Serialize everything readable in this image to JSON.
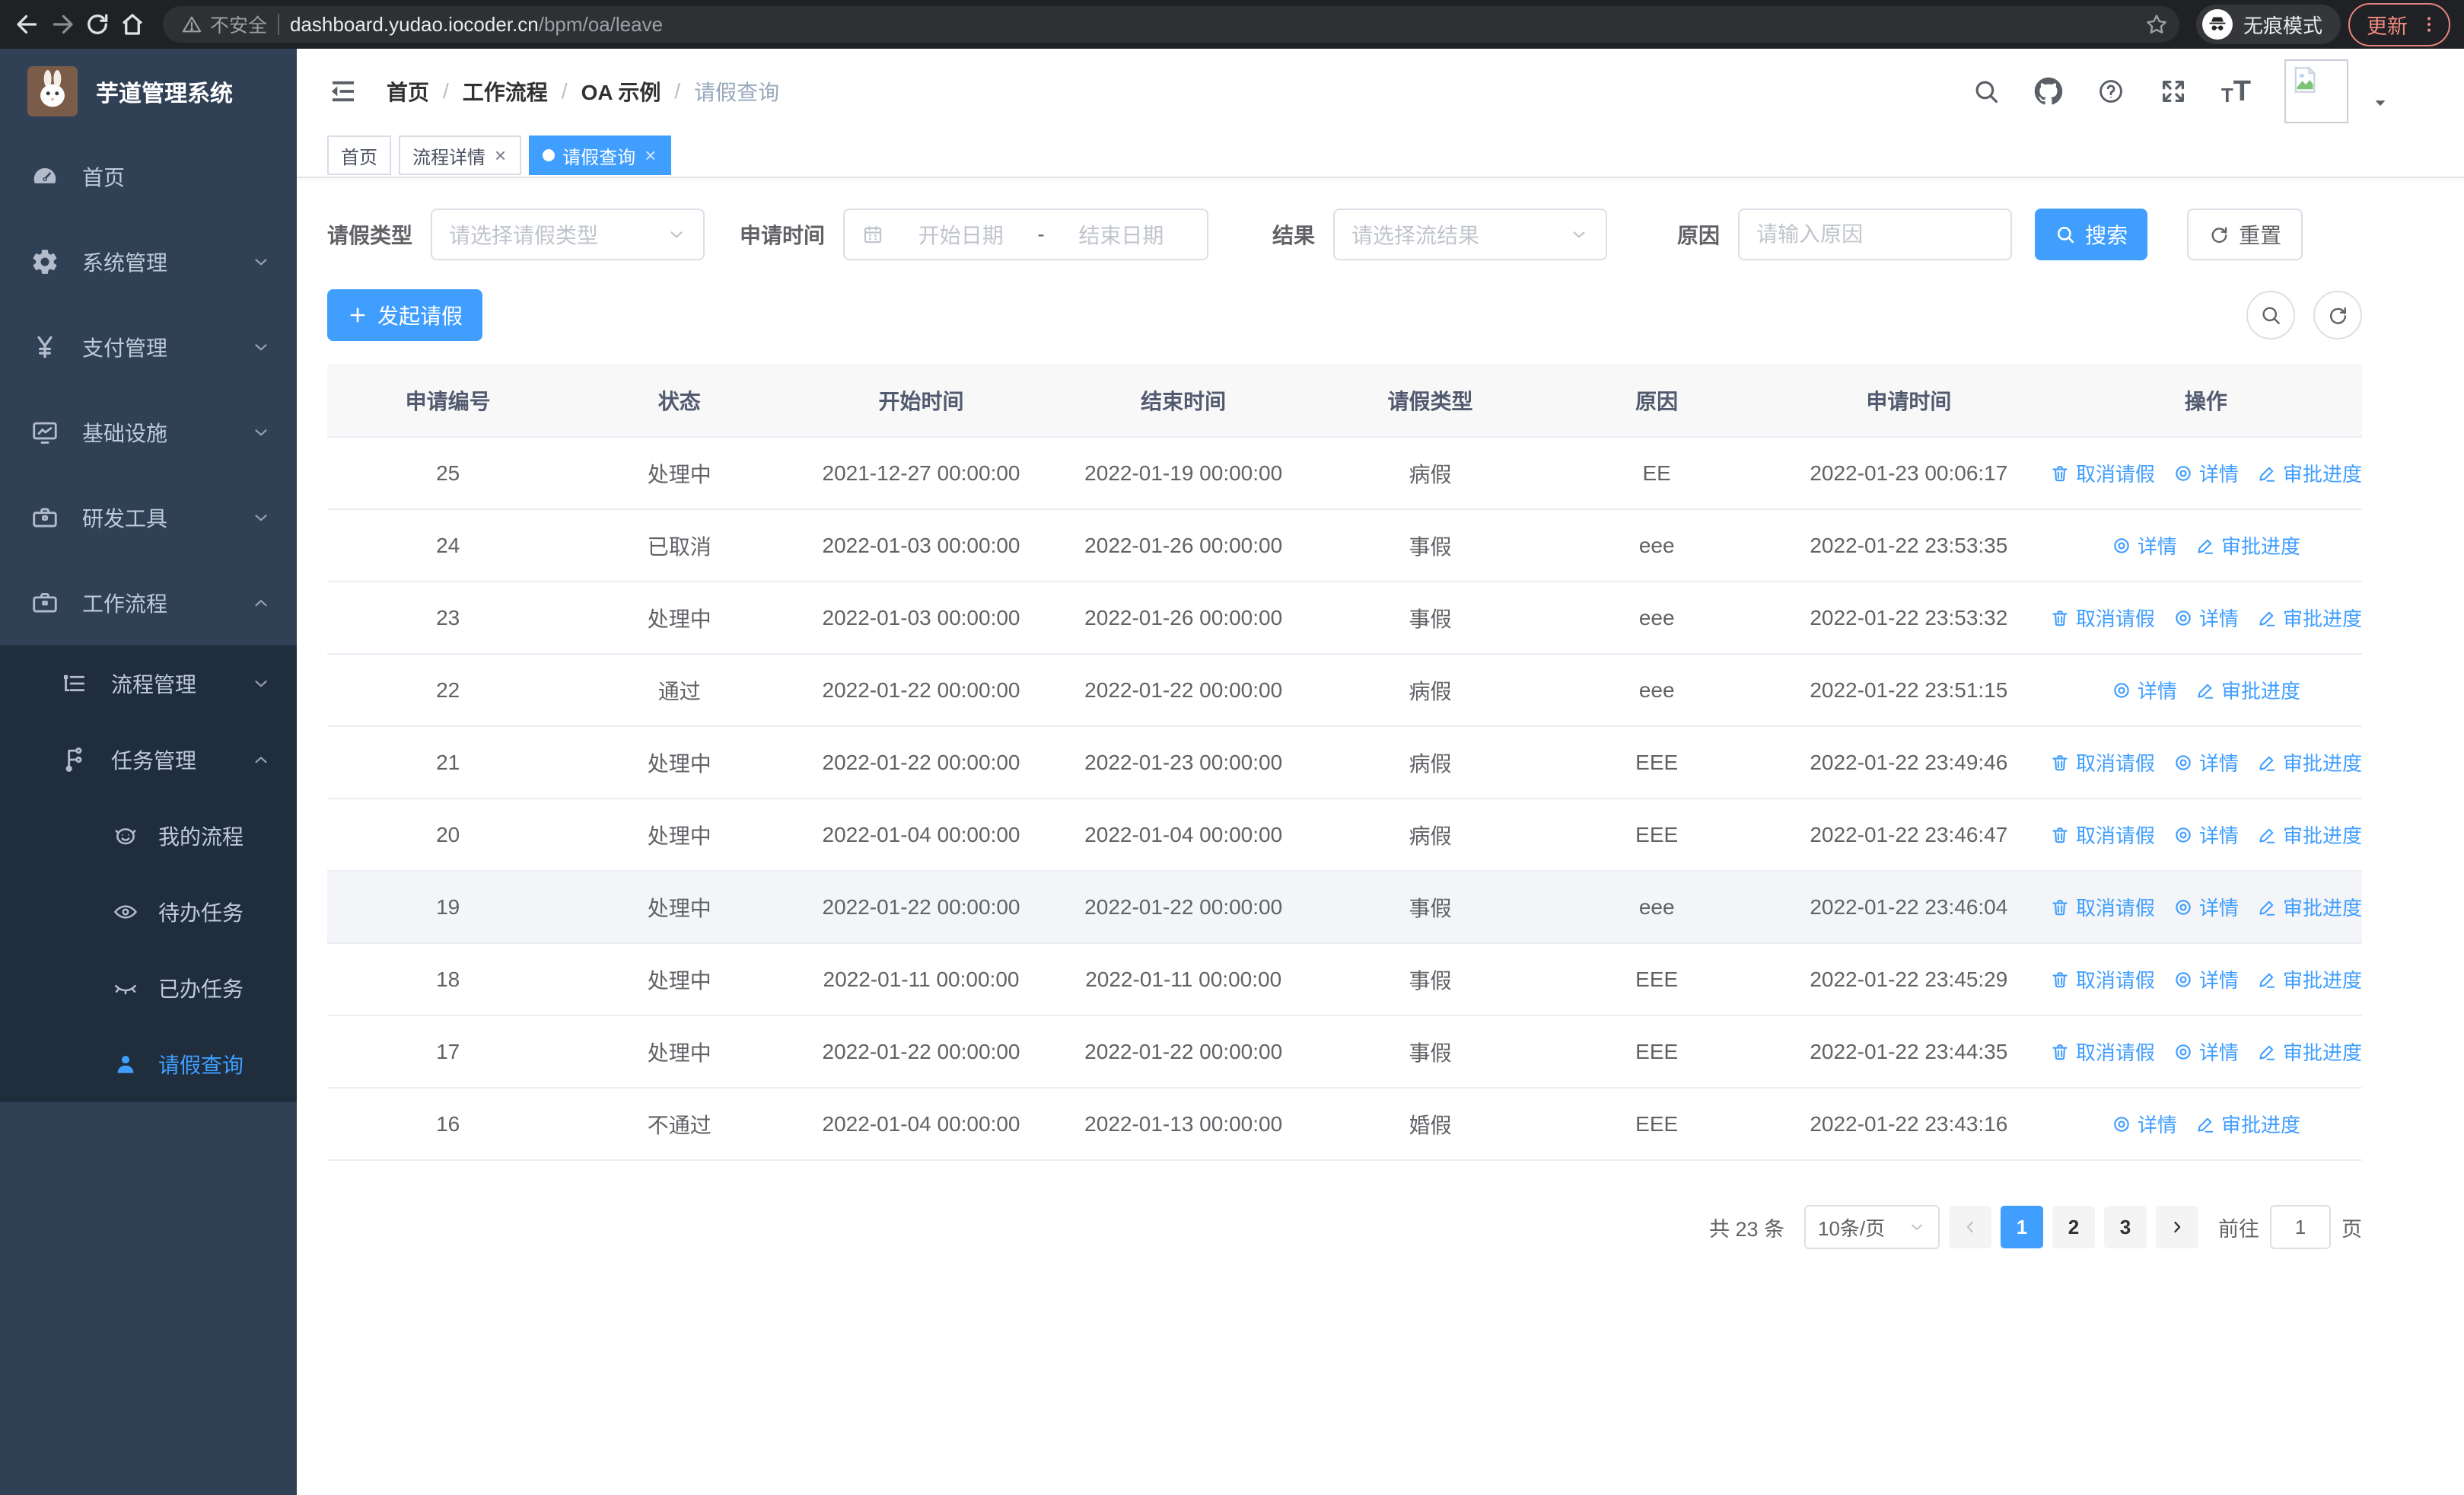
{
  "browser": {
    "security_label": "不安全",
    "url_host": "dashboard.yudao.iocoder.cn",
    "url_path": "/bpm/oa/leave",
    "incognito_label": "无痕模式",
    "update_label": "更新"
  },
  "sidebar": {
    "logo_title": "芋道管理系统",
    "menu": [
      {
        "key": "home",
        "label": "首页",
        "icon": "gauge",
        "level": 0
      },
      {
        "key": "system-management",
        "label": "系统管理",
        "icon": "gear",
        "level": 0,
        "arrow": "down"
      },
      {
        "key": "payment-management",
        "label": "支付管理",
        "icon": "yen",
        "level": 0,
        "arrow": "down"
      },
      {
        "key": "infrastructure",
        "label": "基础设施",
        "icon": "monitor",
        "level": 0,
        "arrow": "down"
      },
      {
        "key": "dev-tools",
        "label": "研发工具",
        "icon": "toolbox",
        "level": 0,
        "arrow": "down"
      },
      {
        "key": "workflow",
        "label": "工作流程",
        "icon": "briefcase",
        "level": 0,
        "arrow": "up"
      },
      {
        "key": "process-management",
        "label": "流程管理",
        "icon": "tree",
        "level": 1,
        "arrow": "down"
      },
      {
        "key": "task-management",
        "label": "任务管理",
        "icon": "flow",
        "level": 1,
        "arrow": "up"
      },
      {
        "key": "my-process",
        "label": "我的流程",
        "icon": "face",
        "level": 2
      },
      {
        "key": "todo-tasks",
        "label": "待办任务",
        "icon": "eye",
        "level": 2
      },
      {
        "key": "done-tasks",
        "label": "已办任务",
        "icon": "eye-closed",
        "level": 2
      },
      {
        "key": "leave-query",
        "label": "请假查询",
        "icon": "user",
        "level": 2,
        "active": true
      }
    ]
  },
  "header": {
    "breadcrumb": [
      "首页",
      "工作流程",
      "OA 示例",
      "请假查询"
    ],
    "breadcrumb_separator": "/"
  },
  "tags": [
    {
      "key": "home",
      "label": "首页",
      "closable": false,
      "active": false
    },
    {
      "key": "process-detail",
      "label": "流程详情",
      "closable": true,
      "active": false
    },
    {
      "key": "leave-query",
      "label": "请假查询",
      "closable": true,
      "active": true
    }
  ],
  "filters": {
    "leave_type_label": "请假类型",
    "leave_type_placeholder": "请选择请假类型",
    "apply_time_label": "申请时间",
    "date_start_placeholder": "开始日期",
    "date_separator": "-",
    "date_end_placeholder": "结束日期",
    "result_label": "结果",
    "result_placeholder": "请选择流结果",
    "reason_label": "原因",
    "reason_placeholder": "请输入原因",
    "search_label": "搜索",
    "reset_label": "重置"
  },
  "toolbar": {
    "create_label": "发起请假"
  },
  "table": {
    "columns": [
      "申请编号",
      "状态",
      "开始时间",
      "结束时间",
      "请假类型",
      "原因",
      "申请时间",
      "操作"
    ],
    "action_labels": {
      "cancel": "取消请假",
      "detail": "详情",
      "progress": "审批进度"
    },
    "rows": [
      {
        "id": "25",
        "status": "处理中",
        "start": "2021-12-27 00:00:00",
        "end": "2022-01-19 00:00:00",
        "type": "病假",
        "reason": "EE",
        "apply_time": "2022-01-23 00:06:17",
        "actions": [
          "cancel",
          "detail",
          "progress"
        ]
      },
      {
        "id": "24",
        "status": "已取消",
        "start": "2022-01-03 00:00:00",
        "end": "2022-01-26 00:00:00",
        "type": "事假",
        "reason": "eee",
        "apply_time": "2022-01-22 23:53:35",
        "actions": [
          "detail",
          "progress"
        ]
      },
      {
        "id": "23",
        "status": "处理中",
        "start": "2022-01-03 00:00:00",
        "end": "2022-01-26 00:00:00",
        "type": "事假",
        "reason": "eee",
        "apply_time": "2022-01-22 23:53:32",
        "actions": [
          "cancel",
          "detail",
          "progress"
        ]
      },
      {
        "id": "22",
        "status": "通过",
        "start": "2022-01-22 00:00:00",
        "end": "2022-01-22 00:00:00",
        "type": "病假",
        "reason": "eee",
        "apply_time": "2022-01-22 23:51:15",
        "actions": [
          "detail",
          "progress"
        ]
      },
      {
        "id": "21",
        "status": "处理中",
        "start": "2022-01-22 00:00:00",
        "end": "2022-01-23 00:00:00",
        "type": "病假",
        "reason": "EEE",
        "apply_time": "2022-01-22 23:49:46",
        "actions": [
          "cancel",
          "detail",
          "progress"
        ]
      },
      {
        "id": "20",
        "status": "处理中",
        "start": "2022-01-04 00:00:00",
        "end": "2022-01-04 00:00:00",
        "type": "病假",
        "reason": "EEE",
        "apply_time": "2022-01-22 23:46:47",
        "actions": [
          "cancel",
          "detail",
          "progress"
        ]
      },
      {
        "id": "19",
        "status": "处理中",
        "start": "2022-01-22 00:00:00",
        "end": "2022-01-22 00:00:00",
        "type": "事假",
        "reason": "eee",
        "apply_time": "2022-01-22 23:46:04",
        "actions": [
          "cancel",
          "detail",
          "progress"
        ],
        "highlighted": true
      },
      {
        "id": "18",
        "status": "处理中",
        "start": "2022-01-11 00:00:00",
        "end": "2022-01-11 00:00:00",
        "type": "事假",
        "reason": "EEE",
        "apply_time": "2022-01-22 23:45:29",
        "actions": [
          "cancel",
          "detail",
          "progress"
        ]
      },
      {
        "id": "17",
        "status": "处理中",
        "start": "2022-01-22 00:00:00",
        "end": "2022-01-22 00:00:00",
        "type": "事假",
        "reason": "EEE",
        "apply_time": "2022-01-22 23:44:35",
        "actions": [
          "cancel",
          "detail",
          "progress"
        ]
      },
      {
        "id": "16",
        "status": "不通过",
        "start": "2022-01-04 00:00:00",
        "end": "2022-01-13 00:00:00",
        "type": "婚假",
        "reason": "EEE",
        "apply_time": "2022-01-22 23:43:16",
        "actions": [
          "detail",
          "progress"
        ]
      }
    ]
  },
  "pagination": {
    "total_text": "共 23 条",
    "page_size_text": "10条/页",
    "pages": [
      "1",
      "2",
      "3"
    ],
    "active_page": "1",
    "goto_label": "前往",
    "goto_value": "1",
    "goto_suffix": "页"
  },
  "colors": {
    "accent": "#409eff",
    "sidebar_bg": "#304156",
    "submenu_bg": "#1f2d3d",
    "update_accent": "#f28b82"
  }
}
